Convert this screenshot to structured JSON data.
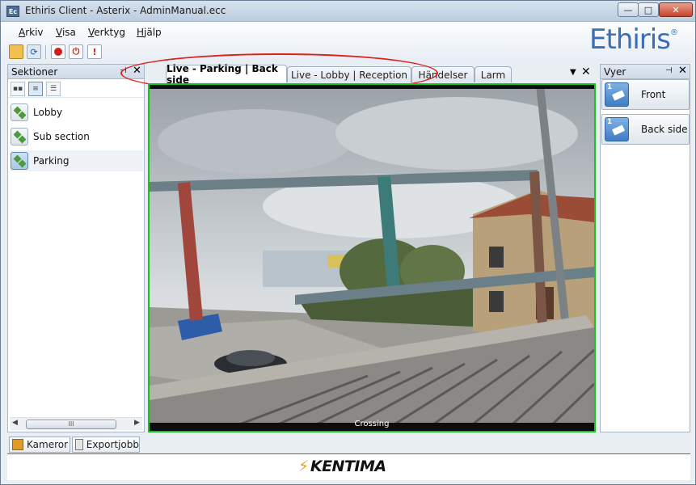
{
  "window": {
    "title": "Ethiris Client - Asterix - AdminManual.ecc",
    "app_icon": "Ec"
  },
  "menu": {
    "items": [
      {
        "ul": "A",
        "rest": "rkiv"
      },
      {
        "ul": "V",
        "rest": "isa"
      },
      {
        "ul": "V",
        "rest": "erktyg"
      },
      {
        "ul": "H",
        "rest": "jälp"
      }
    ]
  },
  "logo": {
    "text": "Ethiris",
    "mark": "®",
    "color": "#3a6fb5"
  },
  "toolbar": {
    "icons": [
      "folder-icon",
      "refresh-icon",
      "record-icon",
      "power-icon",
      "info-icon"
    ]
  },
  "sections_panel": {
    "title": "Sektioner",
    "items": [
      {
        "label": "Lobby"
      },
      {
        "label": "Sub section"
      },
      {
        "label": "Parking"
      }
    ],
    "scroll_thumb": "III"
  },
  "center_tabs": [
    {
      "label": "Live - Parking | Back side"
    },
    {
      "label": "Live - Lobby | Reception"
    },
    {
      "label": "Händelser"
    },
    {
      "label": "Larm"
    }
  ],
  "video": {
    "caption": "Crossing",
    "border_color": "#18c21f"
  },
  "views_panel": {
    "title": "Vyer",
    "items": [
      {
        "number": "1",
        "label": "Front"
      },
      {
        "number": "1",
        "label": "Back side"
      }
    ]
  },
  "bottom_tabs": [
    {
      "label": "Kameror"
    },
    {
      "label": "Exportjobb"
    }
  ],
  "footer": {
    "logo": "KENTIMA"
  },
  "glyphs": {
    "pin": "⊣",
    "close": "✕",
    "menu_down": "▼",
    "minimize": "—",
    "maximize": "□"
  },
  "highlight_color": "#e0201a"
}
